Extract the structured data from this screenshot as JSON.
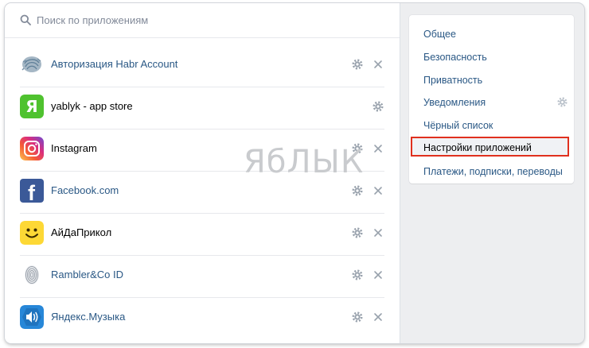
{
  "search": {
    "placeholder": "Поиск по приложениям"
  },
  "apps": [
    {
      "name": "Авторизация Habr Account",
      "icon": "habr-fingerprint-icon",
      "removable": true
    },
    {
      "name": "yablyk - app store",
      "icon": "yablyk-icon",
      "icon_letter": "Я",
      "removable": false
    },
    {
      "name": "Instagram",
      "icon": "instagram-icon",
      "removable": true
    },
    {
      "name": "Facebook.com",
      "icon": "facebook-icon",
      "icon_letter": "f",
      "removable": true
    },
    {
      "name": "АйДаПрикол",
      "icon": "smiley-icon",
      "removable": true
    },
    {
      "name": "Rambler&Co ID",
      "icon": "rambler-fingerprint-icon",
      "removable": true
    },
    {
      "name": "Яндекс.Музыка",
      "icon": "yandex-music-icon",
      "removable": true
    }
  ],
  "settings_menu": {
    "items": [
      {
        "label": "Общее"
      },
      {
        "label": "Безопасность"
      },
      {
        "label": "Приватность"
      },
      {
        "label": "Уведомления",
        "has_gear": true
      },
      {
        "label": "Чёрный список"
      },
      {
        "label": "Настройки приложений",
        "active": true
      },
      {
        "label": "Платежи, подписки, переводы"
      }
    ]
  },
  "watermark": {
    "text": "ЯбЛЫК"
  },
  "colors": {
    "link": "#2a5885",
    "highlight_border": "#e0301e",
    "background": "#edeef0",
    "placeholder": "#828a99"
  }
}
